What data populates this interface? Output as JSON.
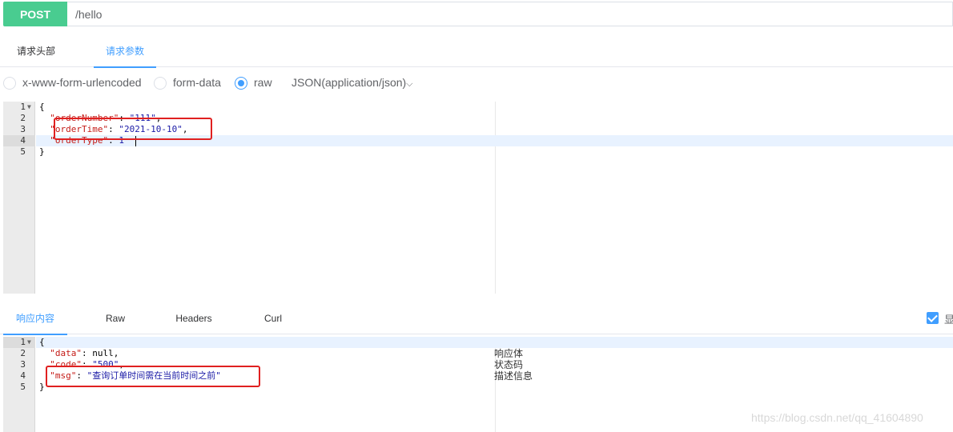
{
  "request": {
    "method": "POST",
    "url": "/hello"
  },
  "request_tabs": [
    {
      "label": "请求头部"
    },
    {
      "label": "请求参数"
    }
  ],
  "body_types": {
    "urlencoded": "x-www-form-urlencoded",
    "formdata": "form-data",
    "raw": "raw",
    "format": "JSON(application/json)"
  },
  "request_editor": {
    "line_numbers": [
      "1",
      "2",
      "3",
      "4",
      "5"
    ],
    "lines": {
      "l1": "{",
      "l2_key": "\"orderNumber\"",
      "l2_sep": ": ",
      "l2_val": "\"111\"",
      "l2_end": ",",
      "l3_key": "\"orderTime\"",
      "l3_sep": ": ",
      "l3_val": "\"2021-10-10\"",
      "l3_end": ",",
      "l4_key": "\"orderType\"",
      "l4_sep": ": ",
      "l4_val": "1",
      "l5": "}"
    }
  },
  "response_tabs": [
    {
      "label": "响应内容"
    },
    {
      "label": "Raw"
    },
    {
      "label": "Headers"
    },
    {
      "label": "Curl"
    }
  ],
  "response_editor": {
    "line_numbers": [
      "1",
      "2",
      "3",
      "4",
      "5"
    ],
    "lines": {
      "l1": "{",
      "l2_key": "\"data\"",
      "l2_rest": ": null,",
      "l3_key": "\"code\"",
      "l3_sep": ": ",
      "l3_val": "\"500\"",
      "l3_end": ",",
      "l4_key": "\"msg\"",
      "l4_sep": ": ",
      "l4_val": "\"查询订单时间需在当前时间之前\"",
      "l5": "}"
    },
    "notes": [
      "响应体",
      "状态码",
      "描述信息"
    ]
  },
  "show_checkbox_label": "显示说明",
  "watermark": "https://blog.csdn.net/qq_41604890",
  "colors": {
    "method_post": "#49cc90",
    "accent": "#409eff",
    "highlight_box": "#e02020"
  }
}
